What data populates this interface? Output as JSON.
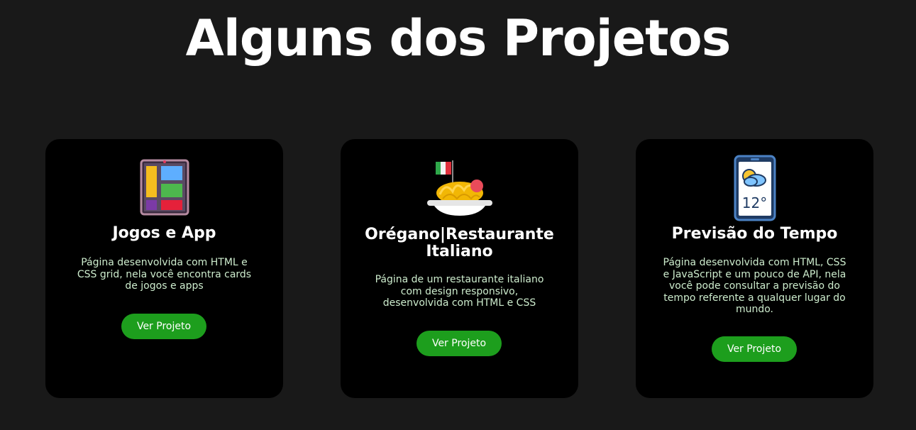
{
  "page": {
    "title": "Alguns dos Projetos"
  },
  "colors": {
    "background": "#191919",
    "card_background": "#000000",
    "button": "#1d9e1d",
    "description_text": "#cdeccd"
  },
  "projects": [
    {
      "icon": "app-layout-icon",
      "title": "Jogos e App",
      "description": "Página desenvolvida com HTML e CSS grid, nela você encontra cards de jogos e apps",
      "button_label": "Ver Projeto"
    },
    {
      "icon": "spaghetti-plate-icon",
      "title": "Orégano|Restaurante Italiano",
      "description": "Página de um restaurante italiano com design responsivo, desenvolvida com HTML e CSS",
      "button_label": "Ver Projeto"
    },
    {
      "icon": "weather-phone-icon",
      "title": "Previsão do Tempo",
      "description": "Página desenvolvida com HTML, CSS e JavaScript e um pouco de API, nela você pode consultar a previsão do tempo referente a qualquer lugar do mundo.",
      "button_label": "Ver Projeto",
      "weather_temp": "12°"
    }
  ]
}
